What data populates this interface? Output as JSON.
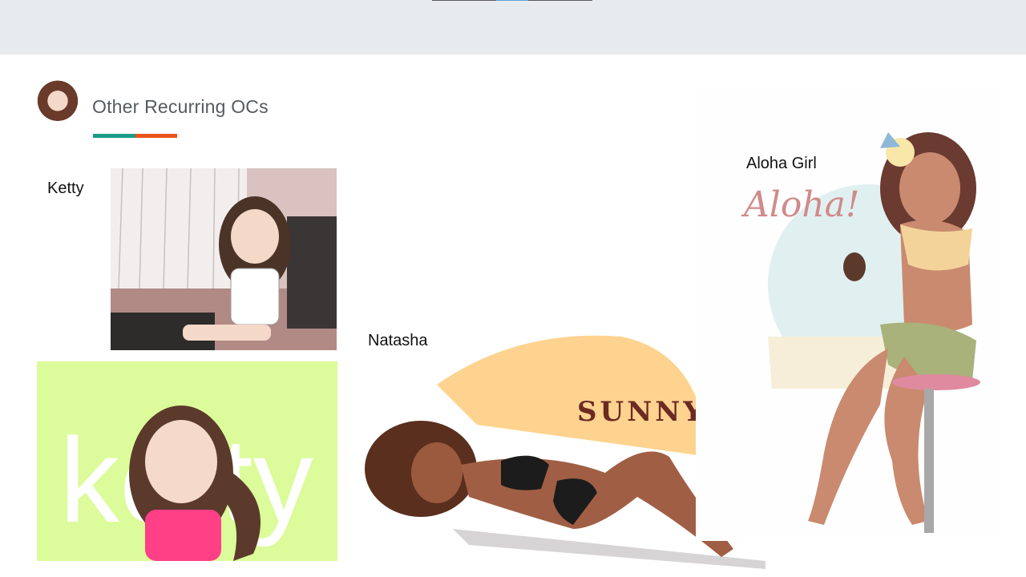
{
  "section": {
    "title": "Other Recurring OCs",
    "accent_colors": {
      "teal": "#1a9b86",
      "orange": "#e8541c"
    }
  },
  "characters": [
    {
      "name": "Ketty"
    },
    {
      "name": "Natasha",
      "art_text": "SUNNY"
    },
    {
      "name": "Aloha Girl",
      "art_text": "Aloha!"
    }
  ],
  "ketty_banner": {
    "art_text": "ketty"
  },
  "icons": {
    "avatar": "author-avatar-icon"
  }
}
